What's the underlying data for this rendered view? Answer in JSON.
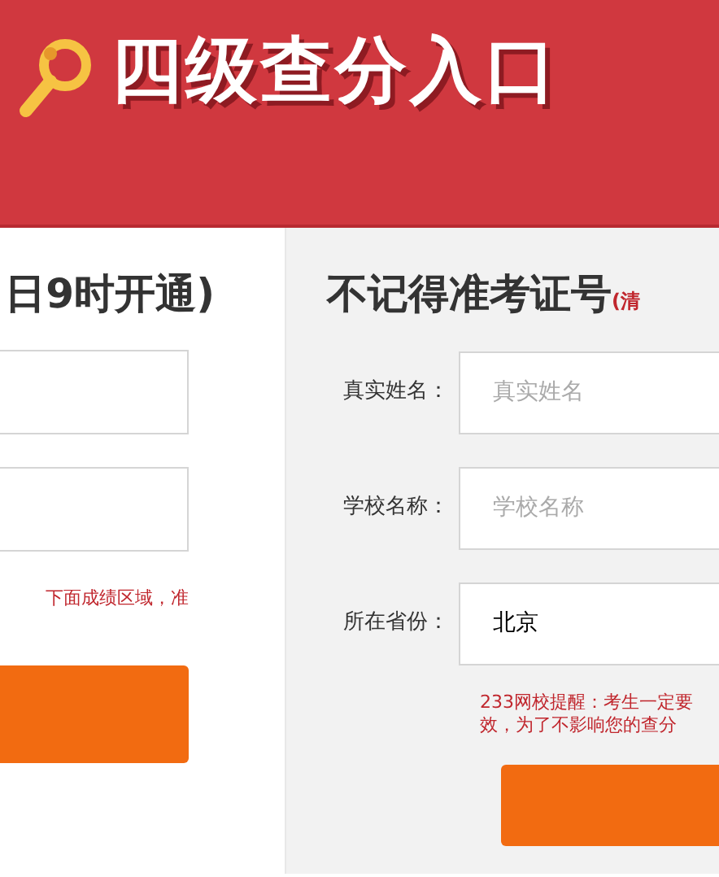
{
  "header": {
    "title": "四级查分入口"
  },
  "left_panel": {
    "heading": "日9时开通)",
    "fields": [
      {
        "kind": "text"
      },
      {
        "kind": "text"
      }
    ],
    "notice": "下面成绩区域，准"
  },
  "right_panel": {
    "heading": "不记得准考证号",
    "heading_note": "(清",
    "fields": [
      {
        "kind": "text",
        "label": "真实姓名：",
        "placeholder": "真实姓名"
      },
      {
        "kind": "text",
        "label": "学校名称：",
        "placeholder": "学校名称"
      },
      {
        "kind": "select",
        "label": "所在省份：",
        "value": "北京"
      }
    ],
    "notice": [
      "233网校提醒：考生一定要",
      "效，为了不影响您的查分"
    ]
  }
}
